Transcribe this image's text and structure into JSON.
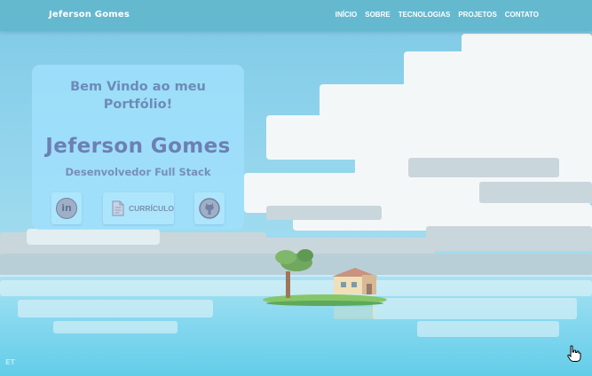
{
  "navbar": {
    "brand": "Jeferson Gomes",
    "links": [
      "INÍCIO",
      "SOBRE",
      "TECNOLOGIAS",
      "PROJETOS",
      "CONTATO"
    ]
  },
  "hero": {
    "welcome_line1": "Bem Vindo ao meu",
    "welcome_line2": "Portfólio!",
    "name": "Jeferson Gomes",
    "role": "Desenvolvedor Full Stack",
    "linkedin_icon_text": "in",
    "resume_label": "CURRÍCULO"
  },
  "corner_badge": "ET",
  "icons": [
    "linkedin-icon",
    "document-icon",
    "github-icon",
    "hand-pointer-icon"
  ],
  "colors": {
    "navbar": "#62b7cd",
    "card": "#a0e0fc",
    "heading": "#6d8bb8",
    "sky": "#8fd3ec",
    "sea": "#63cde8"
  }
}
